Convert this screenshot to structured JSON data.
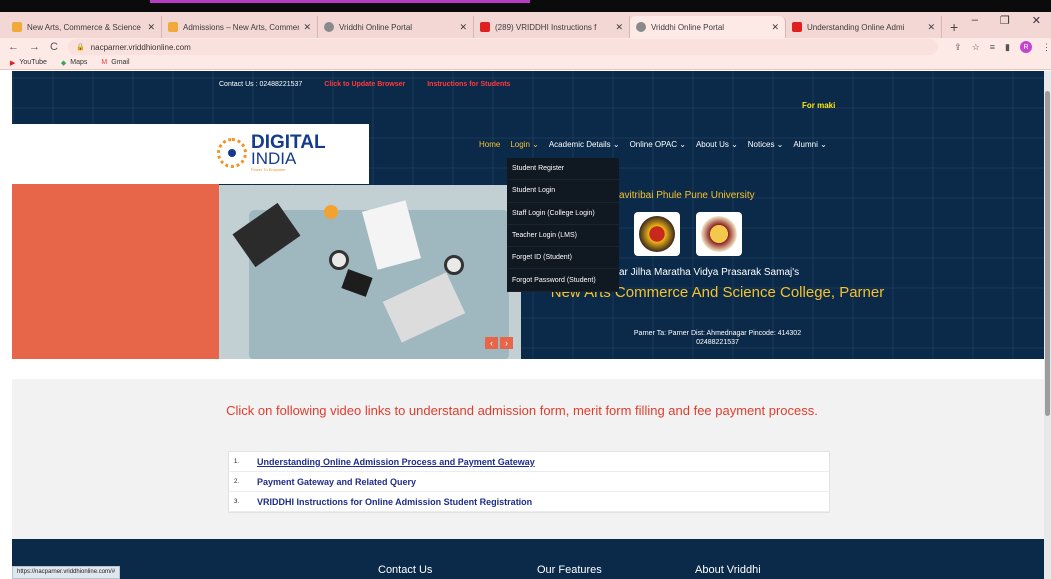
{
  "browser": {
    "tabs": [
      {
        "label": "New Arts, Commerce & Science",
        "fav": "#f2a93c"
      },
      {
        "label": "Admissions – New Arts, Commer",
        "fav": "#f2a93c"
      },
      {
        "label": "Vriddhi Online Portal",
        "fav": "#8a8a8a"
      },
      {
        "label": "(289) VRIDDHI Instructions f",
        "fav": "#e02020"
      },
      {
        "label": "Vriddhi Online Portal",
        "fav": "#8a8a8a",
        "active": true
      },
      {
        "label": "Understanding Online Admi",
        "fav": "#e02020"
      }
    ],
    "new_tab": "+",
    "url": "nacparner.vriddhionline.com",
    "profile_initial": "R",
    "bookmarks": [
      "YouTube",
      "Maps",
      "Gmail"
    ],
    "status_url": "https://nacparner.vriddhionline.com/#"
  },
  "topbar": {
    "contact": "Contact Us : 02488221537",
    "update_link": "Click to Update Browser",
    "instructions_link": "Instructions for Students",
    "ticker": "For maki"
  },
  "logo": {
    "line1": "DIGITAL",
    "line2": "INDIA",
    "tagline": "Power To Empower"
  },
  "nav": {
    "items": [
      "Home",
      "Login ⌄",
      "Academic Details ⌄",
      "Online OPAC ⌄",
      "About Us ⌄",
      "Notices ⌄",
      "Alumni ⌄"
    ]
  },
  "login_menu": [
    "Student Register",
    "Student Login",
    "Staff Login (College Login)",
    "Teacher Login (LMS)",
    "Forget ID (Student)",
    "Forgot Password (Student)"
  ],
  "hero": {
    "university": "avitribai Phule Pune University",
    "samaj": "ar Jilha Maratha Vidya Prasarak Samaj's",
    "college": "New Arts Commerce And Science College, Parner",
    "address": "Parner Ta: Parner Dist: Ahmednagar Pincode: 414302",
    "phone": "02488221537",
    "prev": "‹",
    "next": "›"
  },
  "videos": {
    "heading": "Click on following video links to understand admission form, merit form filling and fee payment process.",
    "items": [
      {
        "num": "1.",
        "label": "Understanding Online Admission Process and Payment Gateway"
      },
      {
        "num": "2.",
        "label": "Payment Gateway and Related Query"
      },
      {
        "num": "3.",
        "label": "VRIDDHI Instructions for Online Admission Student Registration"
      }
    ]
  },
  "footer": {
    "contact": "Contact Us",
    "features": "Our Features",
    "about": "About Vriddhi"
  }
}
